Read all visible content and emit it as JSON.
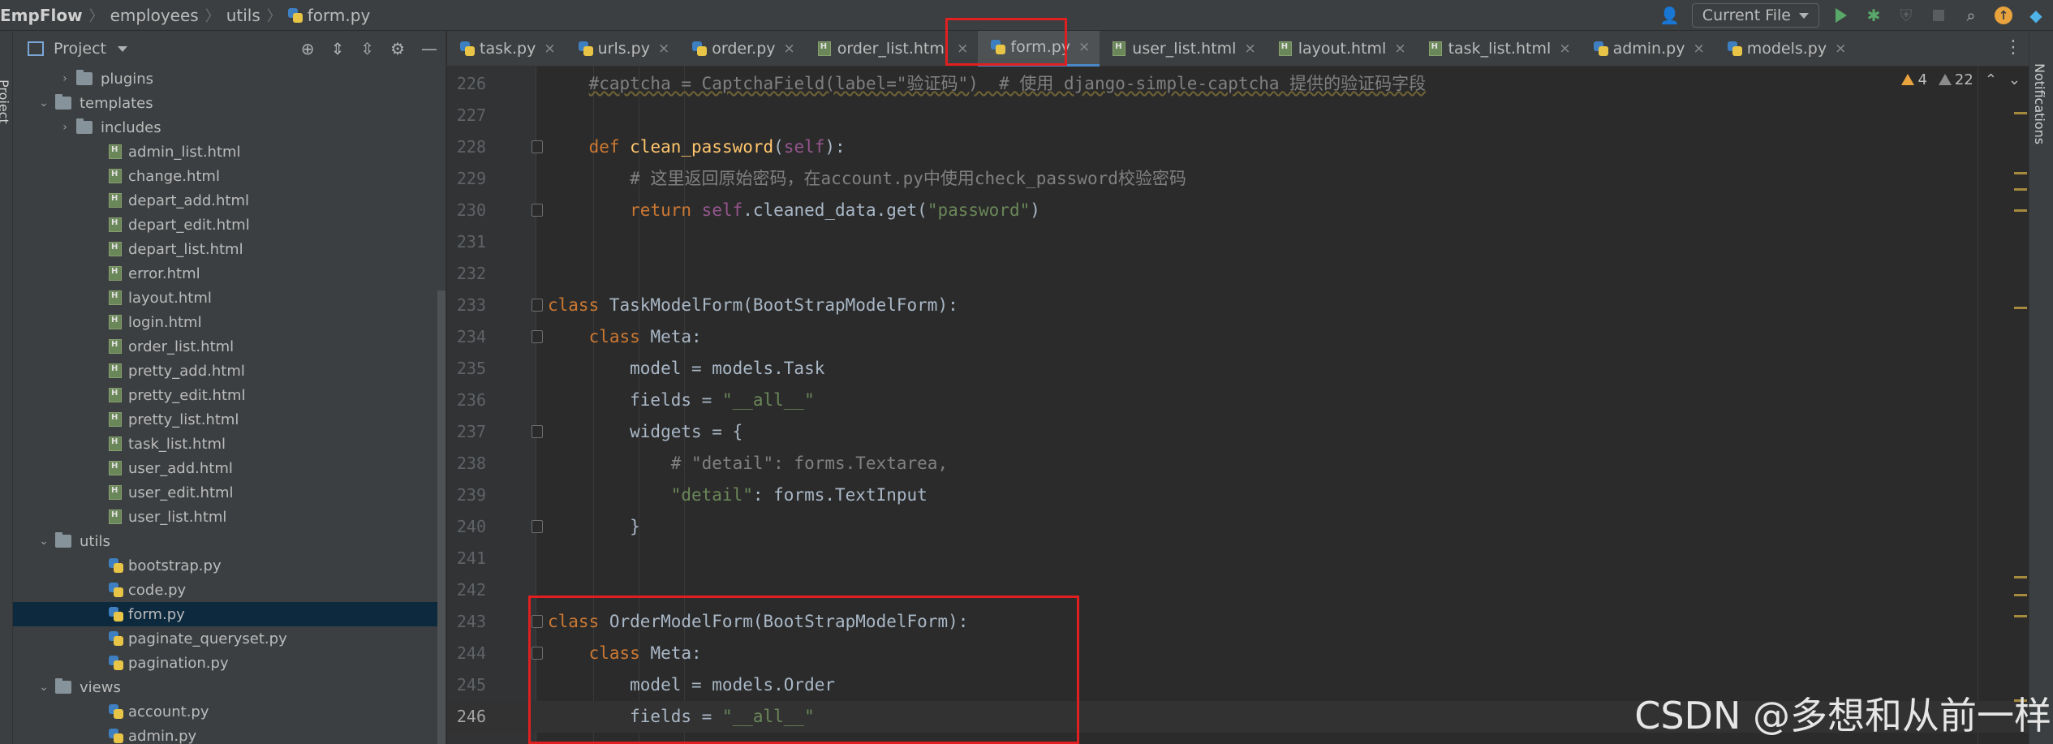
{
  "breadcrumb": {
    "project": "EmpFlow",
    "folder1": "employees",
    "folder2": "utils",
    "file": "form.py"
  },
  "toolbar": {
    "run_config": "Current File"
  },
  "project_panel": {
    "title": "Project",
    "tree": [
      {
        "label": "plugins",
        "type": "folder",
        "indent": 1,
        "expanded": false
      },
      {
        "label": "templates",
        "type": "folder",
        "indent": 0,
        "expanded": true
      },
      {
        "label": "includes",
        "type": "folder",
        "indent": 1,
        "expanded": false
      },
      {
        "label": "admin_list.html",
        "type": "html",
        "indent": 2
      },
      {
        "label": "change.html",
        "type": "html",
        "indent": 2
      },
      {
        "label": "depart_add.html",
        "type": "html",
        "indent": 2
      },
      {
        "label": "depart_edit.html",
        "type": "html",
        "indent": 2
      },
      {
        "label": "depart_list.html",
        "type": "html",
        "indent": 2
      },
      {
        "label": "error.html",
        "type": "html",
        "indent": 2
      },
      {
        "label": "layout.html",
        "type": "html",
        "indent": 2
      },
      {
        "label": "login.html",
        "type": "html",
        "indent": 2
      },
      {
        "label": "order_list.html",
        "type": "html",
        "indent": 2
      },
      {
        "label": "pretty_add.html",
        "type": "html",
        "indent": 2
      },
      {
        "label": "pretty_edit.html",
        "type": "html",
        "indent": 2
      },
      {
        "label": "pretty_list.html",
        "type": "html",
        "indent": 2
      },
      {
        "label": "task_list.html",
        "type": "html",
        "indent": 2
      },
      {
        "label": "user_add.html",
        "type": "html",
        "indent": 2
      },
      {
        "label": "user_edit.html",
        "type": "html",
        "indent": 2
      },
      {
        "label": "user_list.html",
        "type": "html",
        "indent": 2
      },
      {
        "label": "utils",
        "type": "folder",
        "indent": 0,
        "expanded": true
      },
      {
        "label": "bootstrap.py",
        "type": "py",
        "indent": 2
      },
      {
        "label": "code.py",
        "type": "py",
        "indent": 2
      },
      {
        "label": "form.py",
        "type": "py",
        "indent": 2,
        "selected": true
      },
      {
        "label": "paginate_queryset.py",
        "type": "py",
        "indent": 2
      },
      {
        "label": "pagination.py",
        "type": "py",
        "indent": 2
      },
      {
        "label": "views",
        "type": "folder",
        "indent": 0,
        "expanded": true
      },
      {
        "label": "account.py",
        "type": "py",
        "indent": 2
      },
      {
        "label": "admin.py",
        "type": "py",
        "indent": 2
      }
    ]
  },
  "tabs": [
    {
      "label": "task.py",
      "type": "py"
    },
    {
      "label": "urls.py",
      "type": "py"
    },
    {
      "label": "order.py",
      "type": "py"
    },
    {
      "label": "order_list.html",
      "type": "html"
    },
    {
      "label": "form.py",
      "type": "py",
      "active": true
    },
    {
      "label": "user_list.html",
      "type": "html"
    },
    {
      "label": "layout.html",
      "type": "html"
    },
    {
      "label": "task_list.html",
      "type": "html"
    },
    {
      "label": "admin.py",
      "type": "py"
    },
    {
      "label": "models.py",
      "type": "py"
    }
  ],
  "inspections": {
    "warnings": "4",
    "weak_warnings": "22"
  },
  "code_lines": [
    {
      "n": "226",
      "html": "    <span class=\"cmu\">#captcha = CaptchaField(label=\"验证码\")  # 使用 django-simple-captcha 提供的验证码字段</span>"
    },
    {
      "n": "227",
      "html": ""
    },
    {
      "n": "228",
      "html": "    <span class=\"kw\">def </span><span class=\"fn\">clean_password</span>(<span class=\"slf\">self</span>):",
      "fold": true
    },
    {
      "n": "229",
      "html": "        <span class=\"cm\"># 这里返回原始密码，在account.py中使用check_password校验密码</span>"
    },
    {
      "n": "230",
      "html": "        <span class=\"kw\">return </span><span class=\"slf\">self</span>.cleaned_data.get(<span class=\"str\">\"password\"</span>)",
      "fold": true
    },
    {
      "n": "231",
      "html": ""
    },
    {
      "n": "232",
      "html": ""
    },
    {
      "n": "233",
      "html": "<span class=\"kw\">class </span>TaskModelForm(BootStrapModelForm):",
      "fold": true
    },
    {
      "n": "234",
      "html": "    <span class=\"kw\">class </span>Meta:",
      "fold": true
    },
    {
      "n": "235",
      "html": "        model = models.Task"
    },
    {
      "n": "236",
      "html": "        fields = <span class=\"str\">\"__all__\"</span>"
    },
    {
      "n": "237",
      "html": "        widgets = {",
      "fold": true
    },
    {
      "n": "238",
      "html": "            <span class=\"cm\"># \"detail\": forms.Textarea,</span>"
    },
    {
      "n": "239",
      "html": "            <span class=\"str\">\"detail\"</span>: forms.TextInput"
    },
    {
      "n": "240",
      "html": "        }",
      "fold": true
    },
    {
      "n": "241",
      "html": ""
    },
    {
      "n": "242",
      "html": ""
    },
    {
      "n": "243",
      "html": "<span class=\"kw\">class </span>OrderModelForm(BootStrapModelForm):",
      "fold": true
    },
    {
      "n": "244",
      "html": "    <span class=\"kw\">class </span>Meta:",
      "fold": true
    },
    {
      "n": "245",
      "html": "        model = models.Order"
    },
    {
      "n": "246",
      "html": "        fields = <span class=\"str\">\"__all__\"</span>",
      "current": true
    }
  ],
  "watermark": "CSDN @多想和从前一样",
  "colors": {
    "highlight": "#e02020",
    "keyword": "#cc7832",
    "string": "#6a8759",
    "function": "#ffc66d"
  }
}
